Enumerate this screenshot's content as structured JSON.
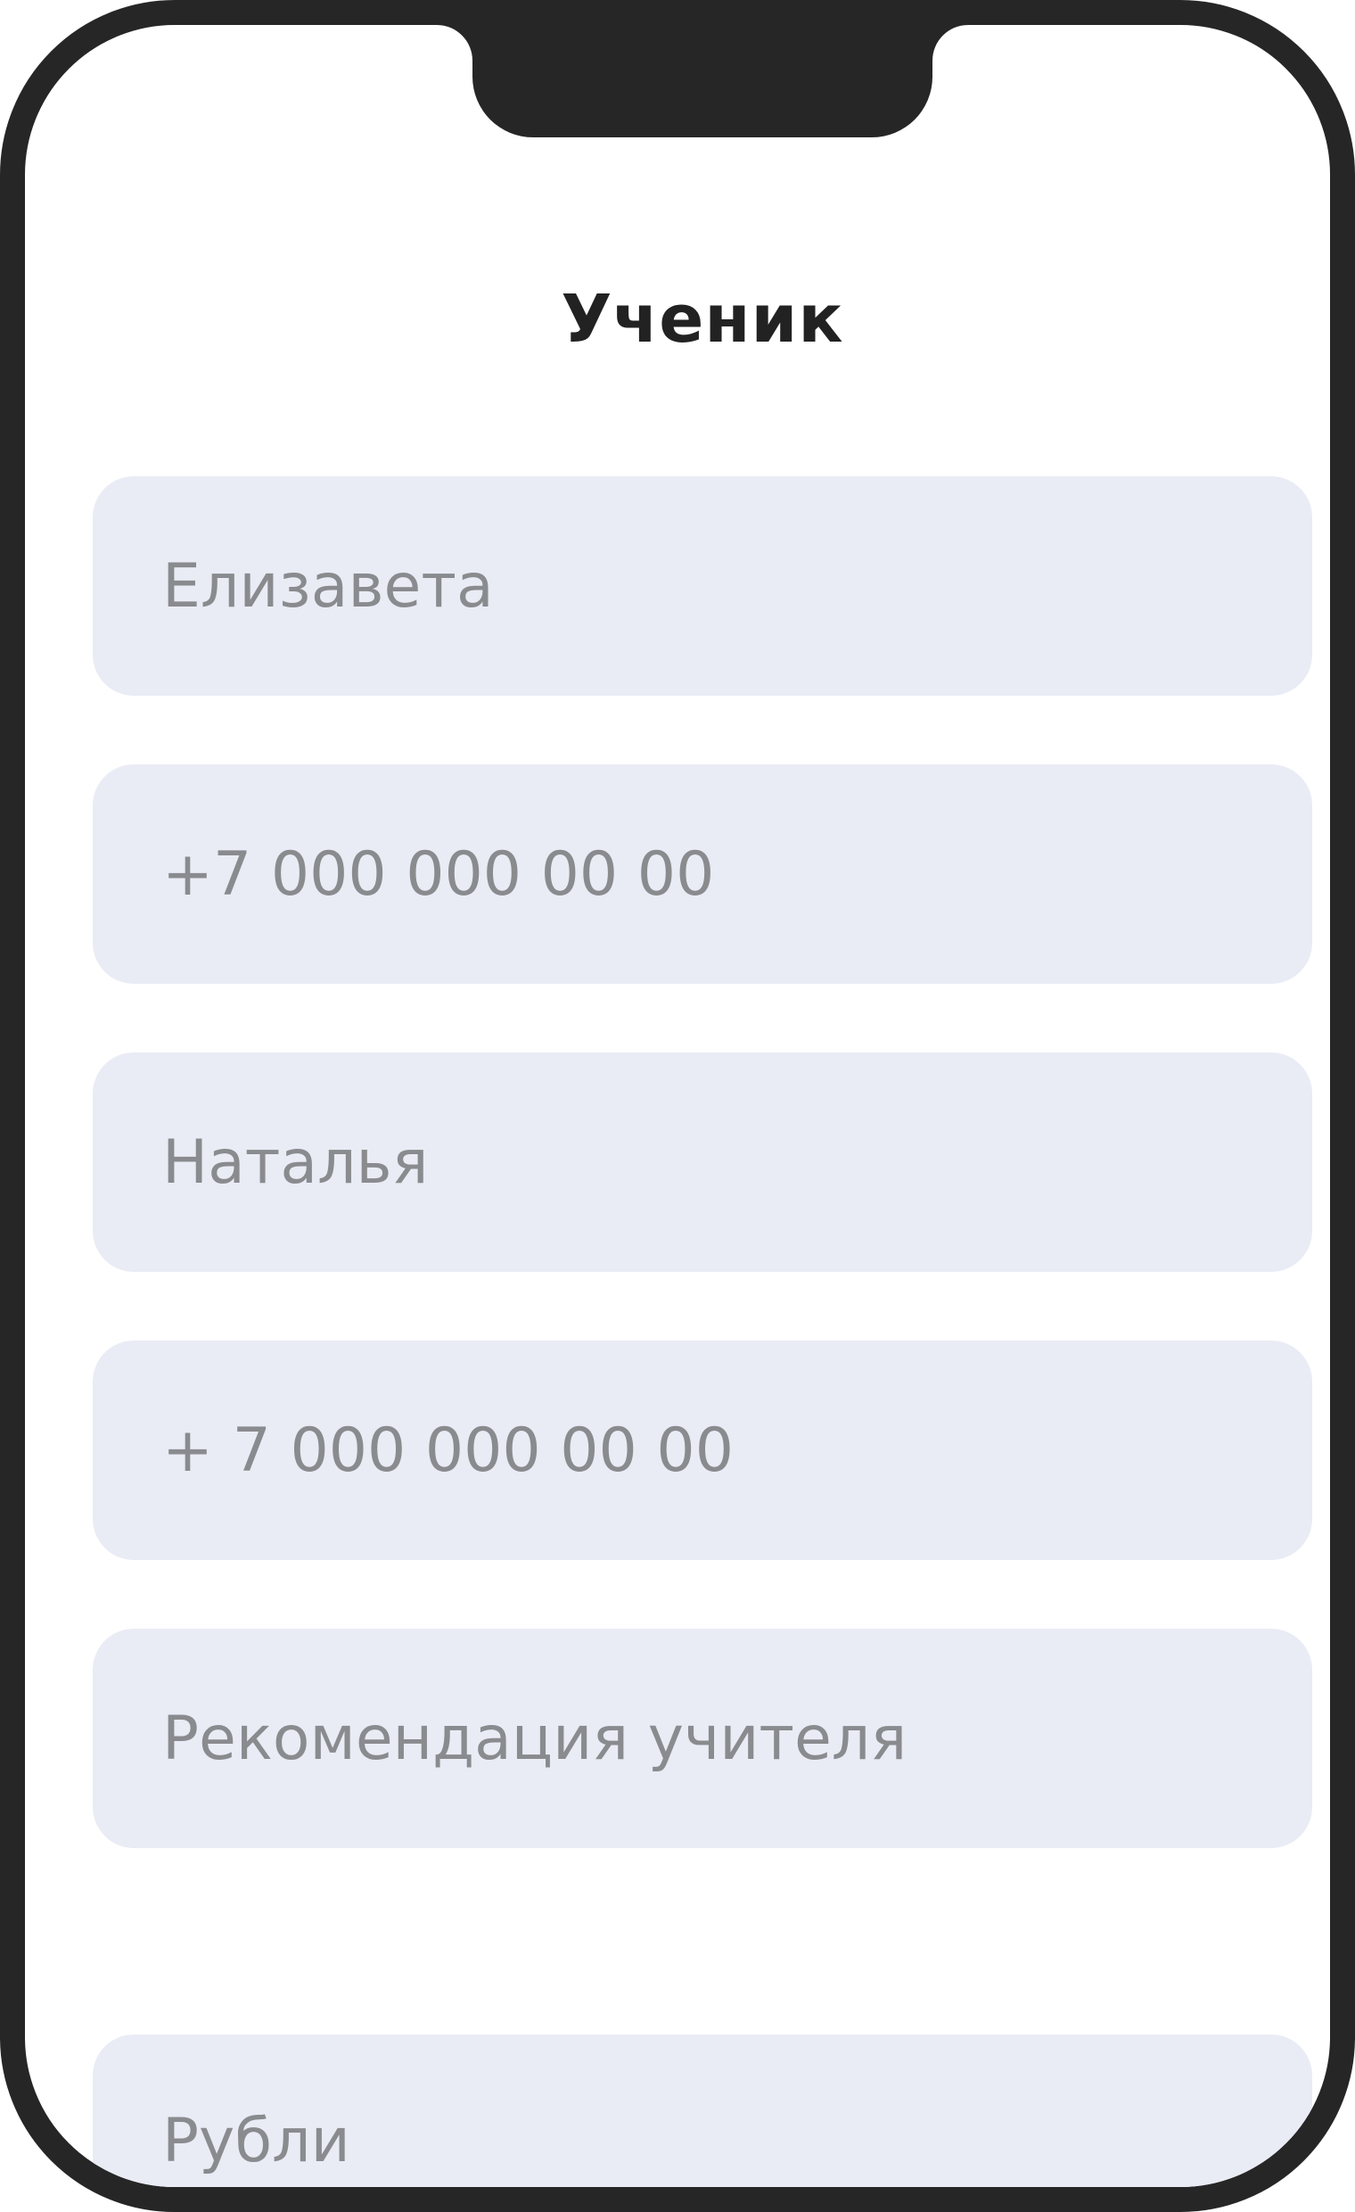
{
  "screen": {
    "title": "Ученик"
  },
  "form": {
    "student_name": "Елизавета",
    "student_phone": "+7 000 000 00 00",
    "parent_name": "Наталья",
    "parent_phone": "+ 7 000 000 00 00",
    "source": "Рекомендация учителя",
    "currency": "Рубли"
  },
  "colors": {
    "frame": "#262626",
    "field_background": "#e9ecf5",
    "field_text": "#8a8b8f",
    "title_text": "#222222"
  }
}
